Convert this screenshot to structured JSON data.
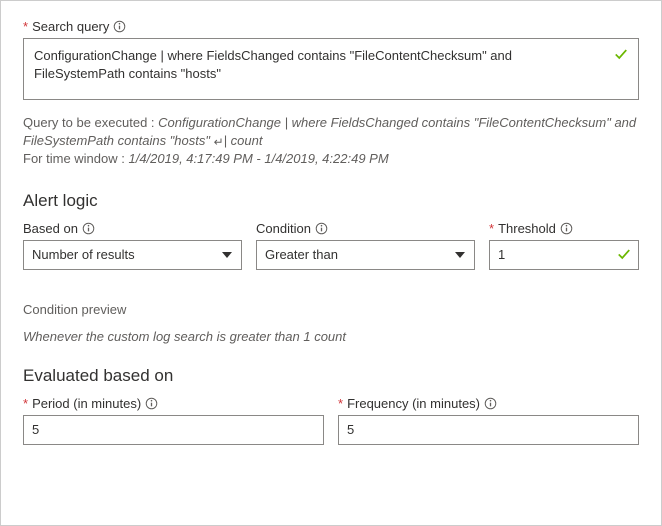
{
  "searchQuery": {
    "label": "Search query",
    "value": "ConfigurationChange | where FieldsChanged contains \"FileContentChecksum\" and FileSystemPath contains \"hosts\""
  },
  "queryDescription": {
    "prefix": "Query to be executed : ",
    "query": "ConfigurationChange | where FieldsChanged contains \"FileContentChecksum\" and FileSystemPath contains \"hosts\"",
    "countSuffix": "| count",
    "timePrefix": "For time window : ",
    "timeRange": "1/4/2019, 4:17:49 PM - 1/4/2019, 4:22:49 PM"
  },
  "alertLogic": {
    "heading": "Alert logic",
    "basedOn": {
      "label": "Based on",
      "value": "Number of results"
    },
    "condition": {
      "label": "Condition",
      "value": "Greater than"
    },
    "threshold": {
      "label": "Threshold",
      "value": "1"
    }
  },
  "conditionPreview": {
    "label": "Condition preview",
    "text": "Whenever the custom log search is greater than 1 count"
  },
  "evaluated": {
    "heading": "Evaluated based on",
    "period": {
      "label": "Period (in minutes)",
      "value": "5"
    },
    "frequency": {
      "label": "Frequency (in minutes)",
      "value": "5"
    }
  }
}
